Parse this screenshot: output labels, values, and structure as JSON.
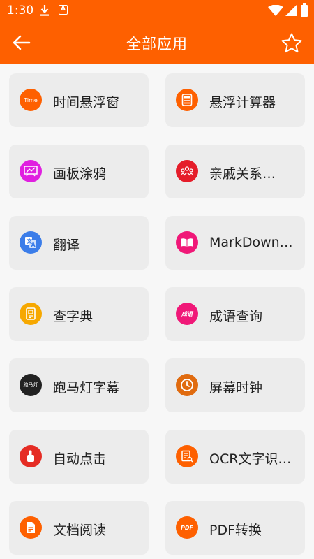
{
  "status": {
    "time": "1:30",
    "a_badge": "A"
  },
  "header": {
    "title": "全部应用"
  },
  "colors": {
    "accent": "#fe6000",
    "card_bg": "#ececec",
    "page_bg": "#f7f7f7"
  },
  "apps": [
    {
      "label": "时间悬浮窗",
      "icon": "time-icon",
      "icon_text": "Time",
      "color": "#fe6000"
    },
    {
      "label": "悬浮计算器",
      "icon": "calculator-icon",
      "color": "#fe6000"
    },
    {
      "label": "画板涂鸦",
      "icon": "drawing-board-icon",
      "color": "#e020e0"
    },
    {
      "label": "亲戚关系…",
      "icon": "relatives-icon",
      "color": "#e51d2a"
    },
    {
      "label": "翻译",
      "icon": "translate-icon",
      "color": "#3b7de9"
    },
    {
      "label": "MarkDown…",
      "icon": "markdown-book-icon",
      "color": "#f01878"
    },
    {
      "label": "查字典",
      "icon": "dictionary-icon",
      "color": "#f6a800"
    },
    {
      "label": "成语查询",
      "icon": "idiom-icon",
      "icon_text": "成语",
      "color": "#f01878"
    },
    {
      "label": "跑马灯字幕",
      "icon": "marquee-icon",
      "icon_text": "跑马灯",
      "color": "#222222"
    },
    {
      "label": "屏幕时钟",
      "icon": "clock-icon",
      "color": "#e06b0f"
    },
    {
      "label": "自动点击",
      "icon": "auto-click-icon",
      "color": "#e52c24"
    },
    {
      "label": "OCR文字识…",
      "icon": "ocr-icon",
      "color": "#fe6000"
    },
    {
      "label": "文档阅读",
      "icon": "document-icon",
      "color": "#fe6000"
    },
    {
      "label": "PDF转换",
      "icon": "pdf-icon",
      "icon_text": "PDF",
      "color": "#fe6000"
    }
  ]
}
